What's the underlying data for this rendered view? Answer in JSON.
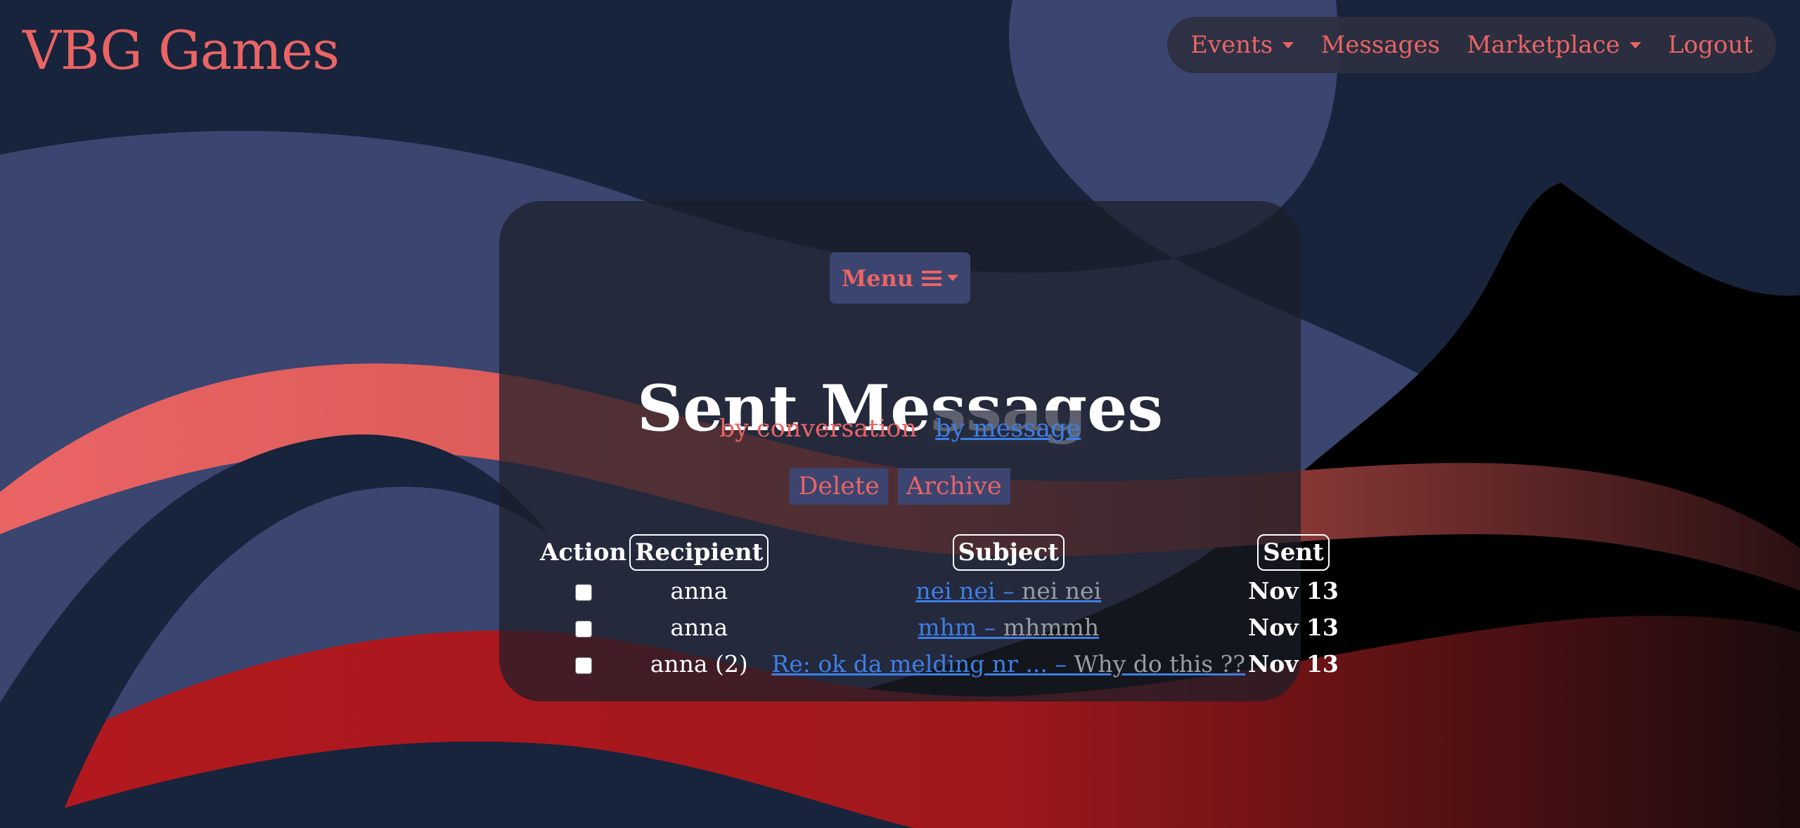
{
  "header": {
    "brand": "VBG Games",
    "nav": [
      "Events",
      "Messages",
      "Marketplace",
      "Logout"
    ]
  },
  "panel": {
    "menu_label": "Menu",
    "title": "Sent Messages",
    "views": [
      "by conversation",
      "by message"
    ],
    "actions": [
      "Delete",
      "Archive"
    ]
  },
  "table": {
    "columns": [
      "Action",
      "Recipient",
      "Subject",
      "Sent"
    ],
    "rows": [
      {
        "recipient": "anna",
        "subject": "nei nei",
        "preview": "nei nei",
        "sent": "Nov 13"
      },
      {
        "recipient": "anna",
        "subject": "mhm",
        "preview": "mhmmh",
        "sent": "Nov 13"
      },
      {
        "recipient": "anna (2)",
        "subject": "Re: ok da melding nr ...",
        "preview": "Why do this ??",
        "sent": "Nov 13"
      }
    ]
  },
  "colors": {
    "accent": "#ea6464",
    "link": "#3d7fe6",
    "background": "#18233c",
    "button_bg": "#3b4570"
  },
  "icons": [
    "chevron-down-icon",
    "hamburger-icon"
  ]
}
